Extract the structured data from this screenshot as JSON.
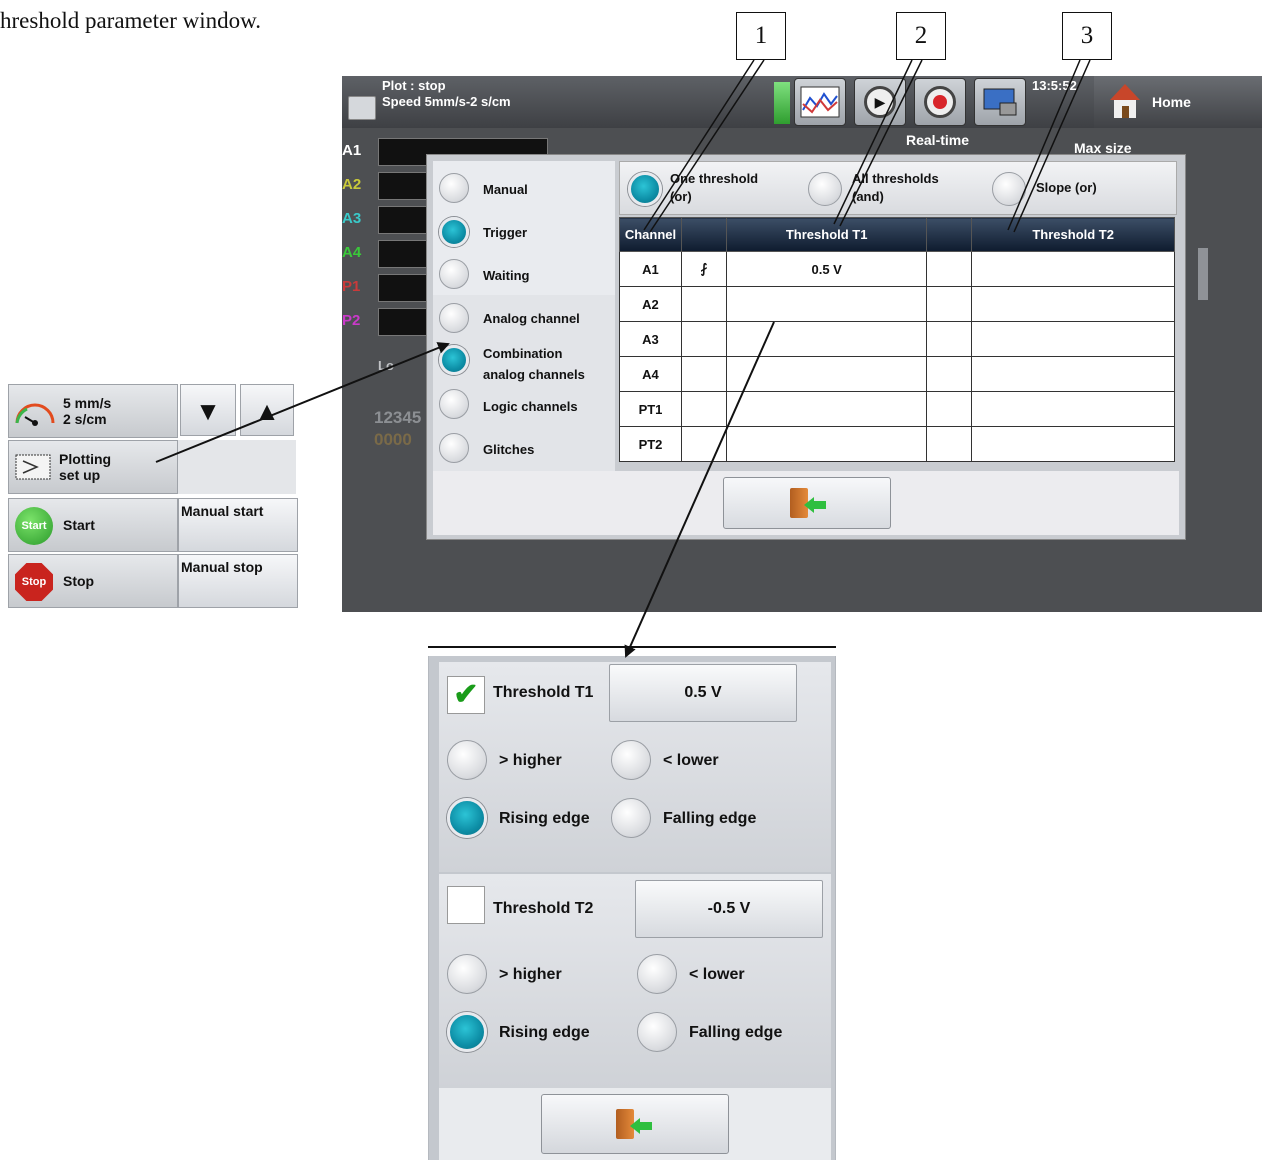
{
  "caption": "hreshold parameter window.",
  "callouts": [
    "1",
    "2",
    "3"
  ],
  "screen": {
    "plot_status": "Plot : stop",
    "speed": "Speed 5mm/s-2 s/cm",
    "time": "13:5:52",
    "home": "Home",
    "realtime": "Real-time",
    "maxsize": "Max size",
    "channels": [
      "A1",
      "A2",
      "A3",
      "A4",
      "P1",
      "P2"
    ],
    "digits_top": "12345",
    "digits_bottom": "0000",
    "lo_label": "Lo"
  },
  "dialog": {
    "trigger_modes": [
      "Manual",
      "Trigger",
      "Waiting"
    ],
    "trigger_selected": "Trigger",
    "sources": [
      "Analog channel",
      "Combination analog channels",
      "Logic channels",
      "Glitches"
    ],
    "source_selected": "Combination analog channels",
    "mode_options": [
      {
        "line1": "One threshold",
        "line2": "(or)",
        "selected": true
      },
      {
        "line1": "All thresholds",
        "line2": "(and)",
        "selected": false
      },
      {
        "line1": "Slope (or)",
        "line2": "",
        "selected": false
      }
    ],
    "columns": [
      "Channel",
      "",
      "Threshold T1",
      "",
      "Threshold T2"
    ],
    "rows": [
      {
        "channel": "A1",
        "edge": "rising-edge-icon",
        "edge_symbol": "⨏",
        "t1": "0.5 V",
        "t2": ""
      },
      {
        "channel": "A2",
        "edge": "",
        "edge_symbol": "",
        "t1": "",
        "t2": ""
      },
      {
        "channel": "A3",
        "edge": "",
        "edge_symbol": "",
        "t1": "",
        "t2": ""
      },
      {
        "channel": "A4",
        "edge": "",
        "edge_symbol": "",
        "t1": "",
        "t2": ""
      },
      {
        "channel": "PT1",
        "edge": "",
        "edge_symbol": "",
        "t1": "",
        "t2": ""
      },
      {
        "channel": "PT2",
        "edge": "",
        "edge_symbol": "",
        "t1": "",
        "t2": ""
      }
    ]
  },
  "side_panel": {
    "speed_line1": "5 mm/s",
    "speed_line2": "2 s/cm",
    "down_arrow": "▼",
    "up_arrow": "▲",
    "plotting_line1": "Plotting",
    "plotting_line2": "set up",
    "start_icon_text": "Start",
    "start": "Start",
    "manual_start": "Manual start",
    "stop_icon_text": "Stop",
    "stop": "Stop",
    "manual_stop": "Manual stop"
  },
  "threshold_window": {
    "t1": {
      "label": "Threshold T1",
      "checked": true,
      "check_glyph": "✔",
      "value": "0.5 V",
      "options": [
        "> higher",
        "< lower",
        "Rising edge",
        "Falling edge"
      ],
      "selected": "Rising edge"
    },
    "t2": {
      "label": "Threshold T2",
      "checked": false,
      "value": "-0.5 V",
      "options": [
        "> higher",
        "< lower",
        "Rising edge",
        "Falling edge"
      ],
      "selected": "Rising edge"
    }
  },
  "colors": {
    "accent_radio": "#0d8ea6",
    "header_dark": "#0e1b2e",
    "exit_arrow": "#2fbf3f",
    "door": "#b25e20"
  }
}
